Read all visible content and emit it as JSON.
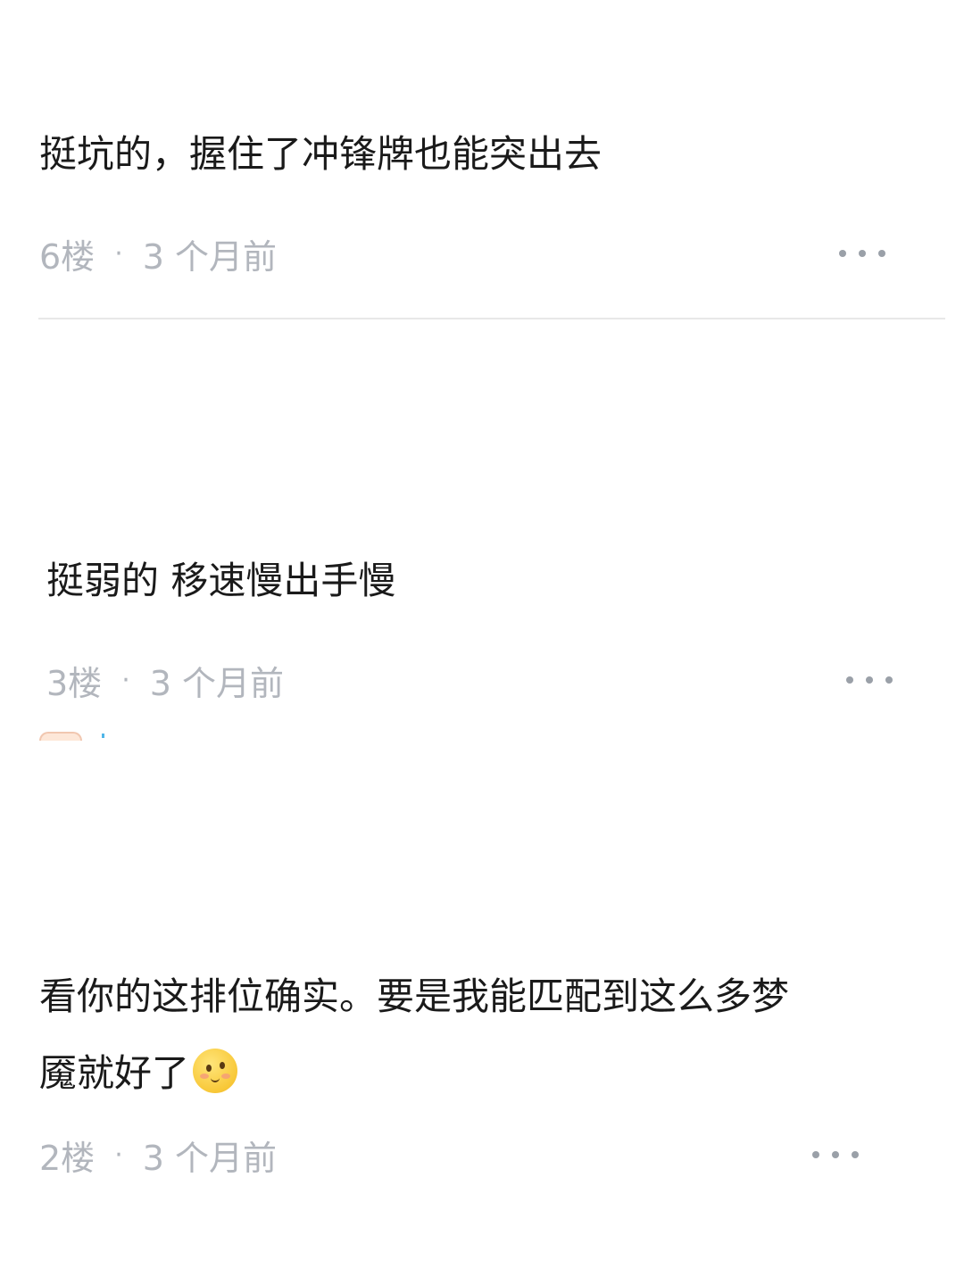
{
  "comments": [
    {
      "text": "挺坑的，握住了冲锋牌也能突出去",
      "floor": "6楼",
      "separator": "·",
      "time": "3 个月前",
      "more_icon": "more-horizontal-icon"
    },
    {
      "text": "挺弱的 移速慢出手慢",
      "floor": "3楼",
      "separator": "·",
      "time": "3 个月前",
      "more_icon": "more-horizontal-icon"
    },
    {
      "text_line1": "看你的这排位确实。要是我能匹配到这么多梦",
      "text_line2": "魇就好了",
      "emoji": "smiling-face-emoji",
      "floor": "2楼",
      "separator": "·",
      "time": "3 个月前",
      "more_icon": "more-horizontal-icon"
    }
  ]
}
